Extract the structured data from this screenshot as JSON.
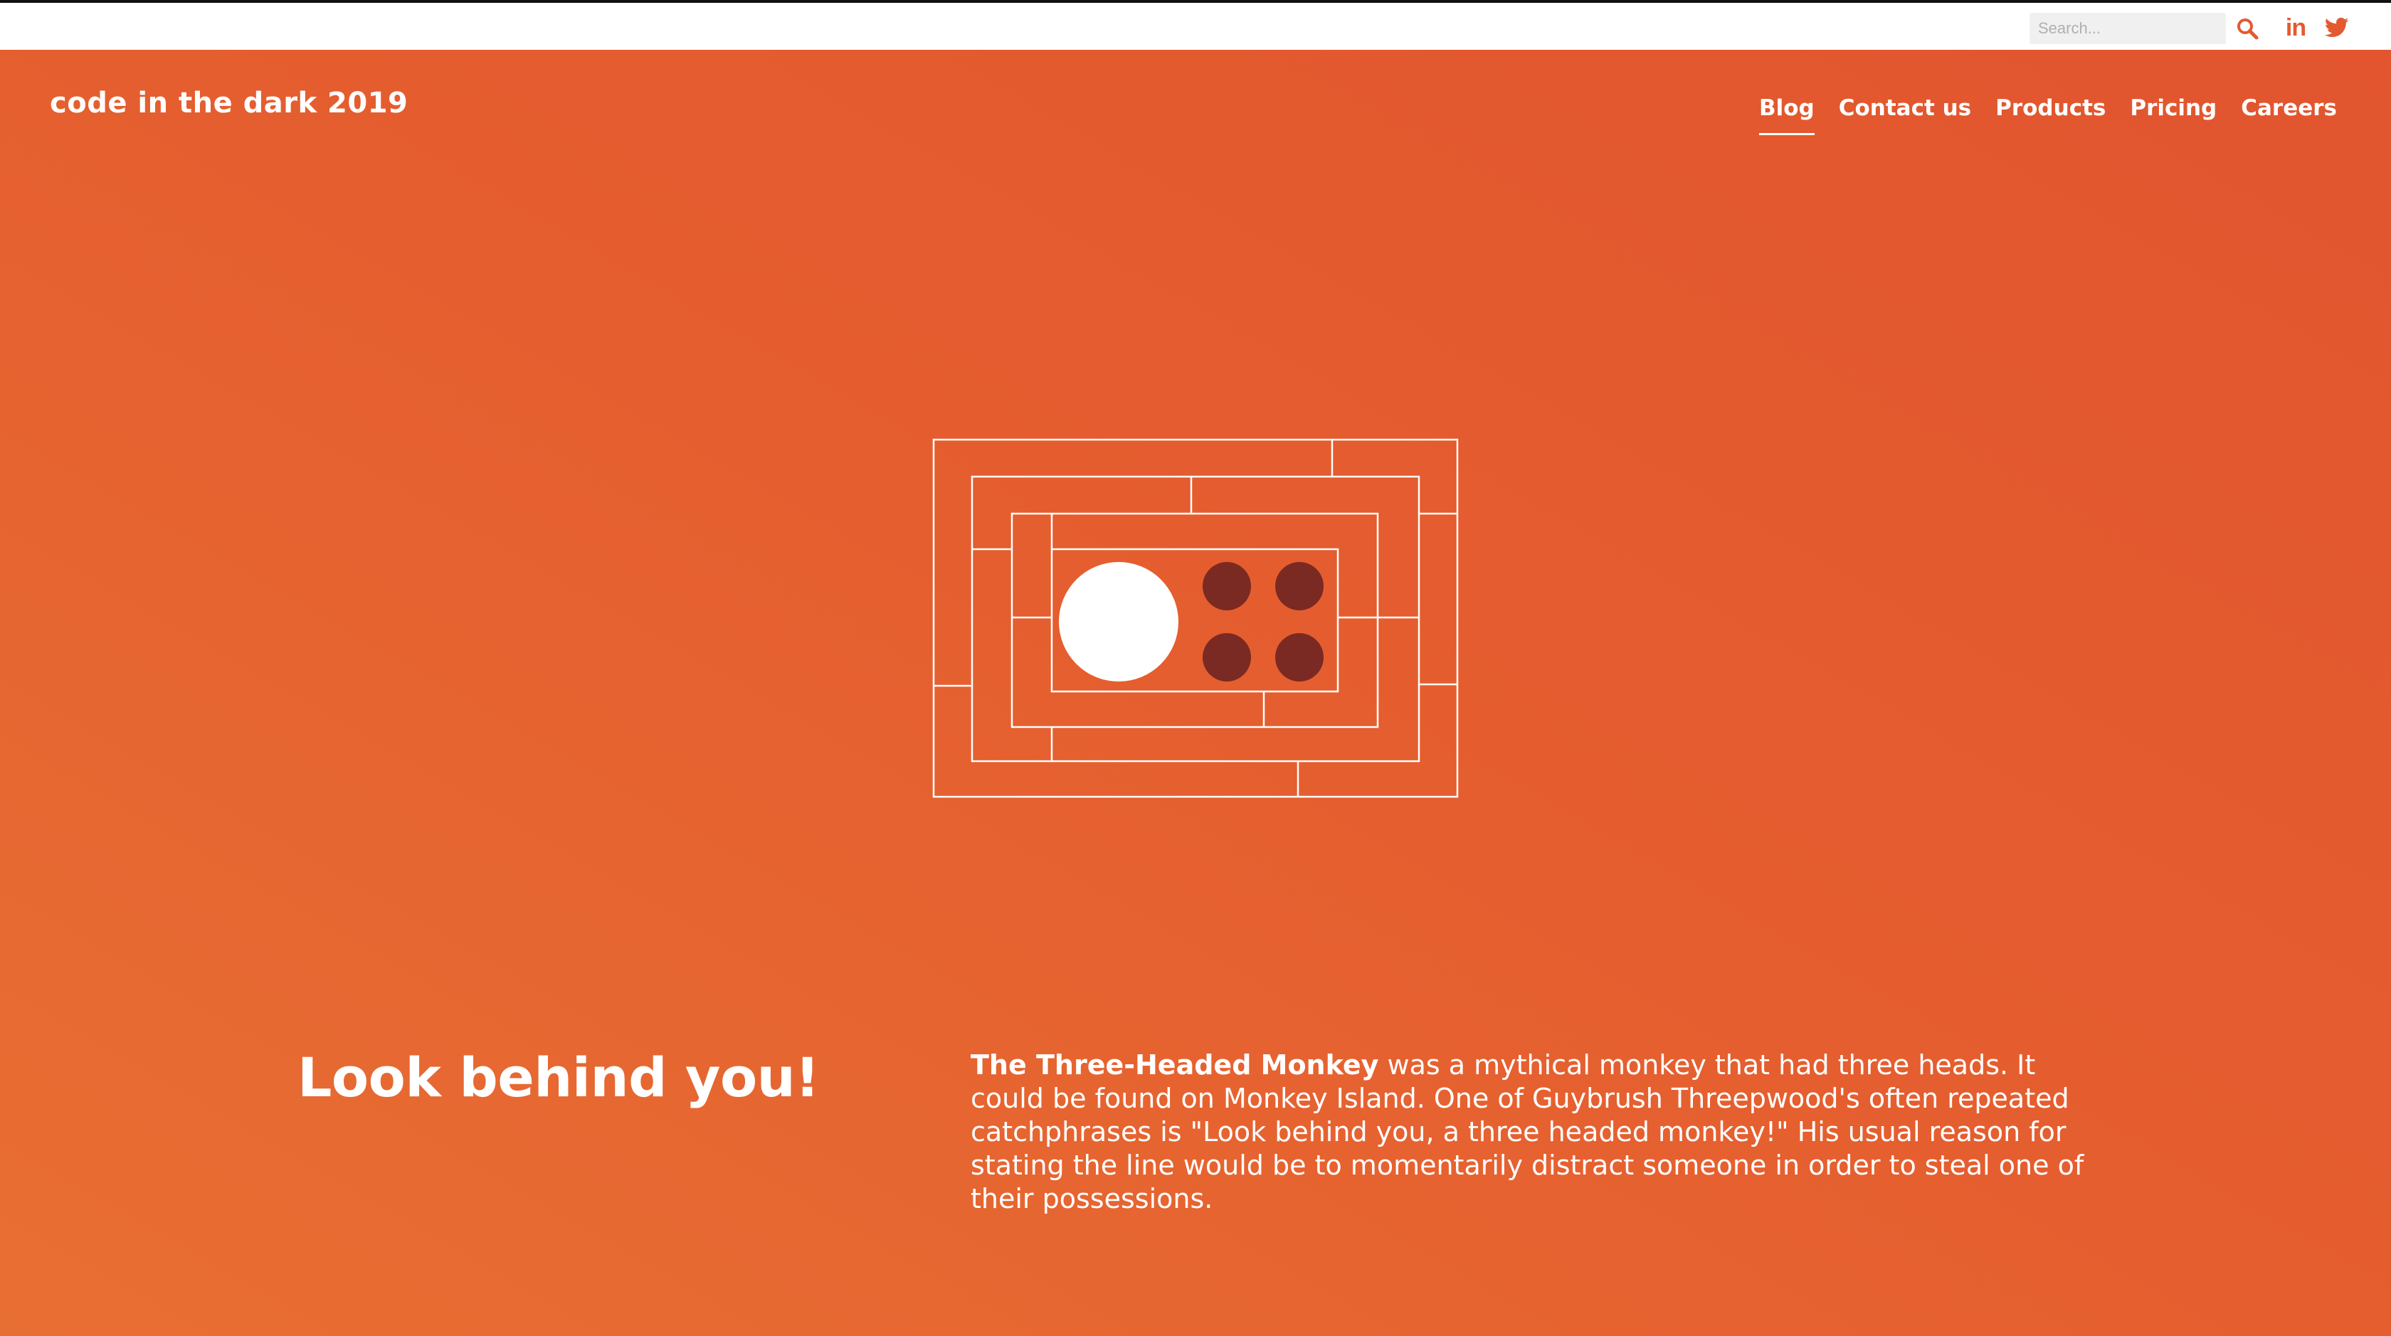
{
  "topbar": {
    "search_placeholder": "Search...",
    "search_icon": "search-icon",
    "social": [
      {
        "name": "linkedin-icon",
        "label": "in"
      },
      {
        "name": "twitter-icon",
        "label": ""
      }
    ]
  },
  "header": {
    "brand": "code in the dark 2019",
    "nav": [
      {
        "label": "Blog",
        "active": true
      },
      {
        "label": "Contact us",
        "active": false
      },
      {
        "label": "Products",
        "active": false
      },
      {
        "label": "Pricing",
        "active": false
      },
      {
        "label": "Careers",
        "active": false
      }
    ]
  },
  "main": {
    "headline": "Look behind you!",
    "body_bold": "The Three-Headed Monkey",
    "body_rest": " was a mythical monkey that had three heads. It could be found on Monkey Island. One of Guybrush Threepwood's often repeated catchphrases is \"Look behind you, a three headed monkey!\" His usual reason for stating the line would be to momentarily distract someone in order to steal one of their possessions."
  },
  "colors": {
    "accent": "#e35a30",
    "hero_start": "#e86f33",
    "hero_end": "#e2552f",
    "dots": "#7a2a22",
    "text": "#ffffff"
  }
}
